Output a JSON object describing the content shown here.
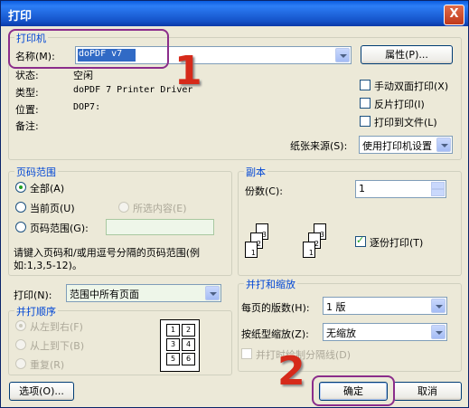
{
  "window": {
    "title": "打印",
    "close_label": "X"
  },
  "printer": {
    "group_label": "打印机",
    "name_label": "名称(M):",
    "name_value": "doPDF v7",
    "properties_button": "属性(P)...",
    "status_label": "状态:",
    "status_value": "空闲",
    "type_label": "类型:",
    "type_value": "doPDF 7 Printer Driver",
    "where_label": "位置:",
    "where_value": "DOP7:",
    "comment_label": "备注:",
    "manual_duplex": "手动双面打印(X)",
    "reverse_print": "反片打印(I)",
    "print_to_file": "打印到文件(L)",
    "paper_source_label": "纸张来源(S):",
    "paper_source_value": "使用打印机设置"
  },
  "page_range": {
    "group_label": "页码范围",
    "all": "全部(A)",
    "current": "当前页(U)",
    "selection": "所选内容(E)",
    "pages": "页码范围(G):",
    "hint": "请键入页码和/或用逗号分隔的页码范围(例如:1,3,5-12)。"
  },
  "copies": {
    "group_label": "副本",
    "count_label": "份数(C):",
    "count_value": "1",
    "collate": "逐份打印(T)",
    "collate_pages": [
      "1",
      "2",
      "3"
    ]
  },
  "print_what": {
    "label": "打印(N):",
    "value": "范围中所有页面"
  },
  "print_order": {
    "group_label": "并打顺序",
    "left_to_right": "从左到右(F)",
    "top_to_bottom": "从上到下(B)",
    "repeat": "重复(R)",
    "preview_cells": [
      "1",
      "2",
      "3",
      "4",
      "5",
      "6"
    ]
  },
  "zoom": {
    "group_label": "并打和缩放",
    "pages_per_sheet_label": "每页的版数(H):",
    "pages_per_sheet_value": "1 版",
    "scale_label": "按纸型缩放(Z):",
    "scale_value": "无缩放",
    "draw_borders": "并打时绘制分隔线(D)"
  },
  "footer": {
    "options_button": "选项(O)...",
    "ok_button": "确定",
    "cancel_button": "取消"
  },
  "annotations": {
    "marker_1": "1",
    "marker_2": "2"
  }
}
